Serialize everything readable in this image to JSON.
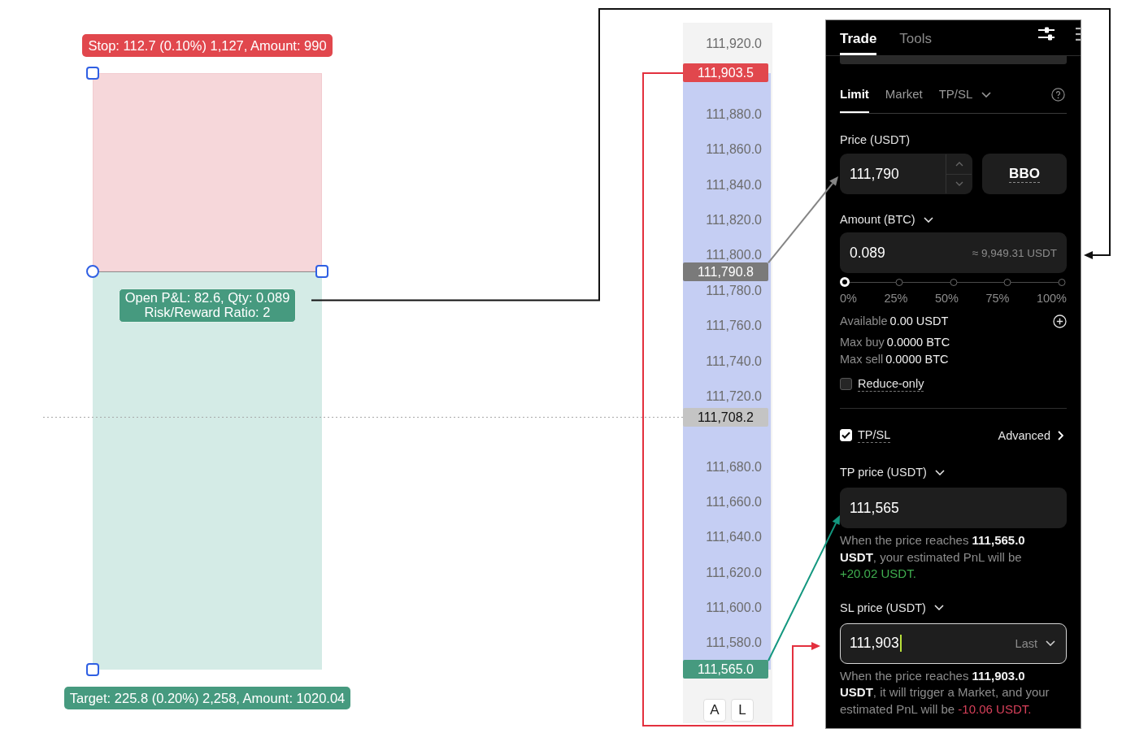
{
  "position_tool": {
    "stop_label": "Stop: 112.7 (0.10%) 1,127, Amount: 990",
    "info_lines": [
      "Open P&L: 82.6, Qty: 0.089",
      "Risk/Reward Ratio: 2"
    ],
    "target_label": "Target: 225.8 (0.20%) 2,258, Amount: 1020.04"
  },
  "price_axis": {
    "ticks": [
      "111,920.0",
      "111,880.0",
      "111,860.0",
      "111,840.0",
      "111,820.0",
      "111,800.0",
      "111,780.0",
      "111,760.0",
      "111,740.0",
      "111,720.0",
      "111,680.0",
      "111,660.0",
      "111,640.0",
      "111,620.0",
      "111,600.0",
      "111,580.0"
    ],
    "markers": [
      {
        "kind": "stop",
        "text": "111,903.5"
      },
      {
        "kind": "entry",
        "text": "111,790.8"
      },
      {
        "kind": "last",
        "text": "111,708.2"
      },
      {
        "kind": "target",
        "text": "111,565.0"
      }
    ],
    "buttons": [
      "A",
      "L"
    ]
  },
  "trade_panel": {
    "tabs": [
      {
        "label": "Trade",
        "selected": true
      },
      {
        "label": "Tools",
        "selected": false
      }
    ],
    "order_types": [
      {
        "label": "Limit",
        "selected": true,
        "dropdown": false
      },
      {
        "label": "Market",
        "selected": false,
        "dropdown": false
      },
      {
        "label": "TP/SL",
        "selected": false,
        "dropdown": true
      }
    ],
    "price": {
      "label": "Price (USDT)",
      "value": "111,790"
    },
    "bbo_button": "BBO",
    "amount": {
      "label": "Amount (BTC)",
      "value": "0.089",
      "conversion": "≈ 9,949.31 USDT"
    },
    "amount_slider": {
      "level": 0,
      "marks": [
        "0%",
        "25%",
        "50%",
        "75%",
        "100%"
      ]
    },
    "available": {
      "label": "Available",
      "value": "0.00 USDT"
    },
    "limits": [
      {
        "label": "Max buy",
        "value": "0.0000 BTC"
      },
      {
        "label": "Max sell",
        "value": "0.0000 BTC"
      }
    ],
    "reduce_only": {
      "label": "Reduce-only",
      "checked": false
    },
    "tpsl": {
      "label": "TP/SL",
      "checked": true,
      "advanced": "Advanced"
    },
    "tp": {
      "label": "TP price (USDT)",
      "value": "111,565",
      "focused": false,
      "hint": "When the price reaches **111,565.0 USDT**, your estimated PnL will be",
      "pnl": "+20.02 USDT.",
      "positive": true
    },
    "sl": {
      "label": "SL price (USDT)",
      "value": "111,903",
      "focused": true,
      "trigger": "Last",
      "hint": "When the price reaches **111,903.0 USDT**, it will trigger a Market, and your estimated PnL will be",
      "pnl": "-10.06 USDT.",
      "positive": false
    }
  }
}
